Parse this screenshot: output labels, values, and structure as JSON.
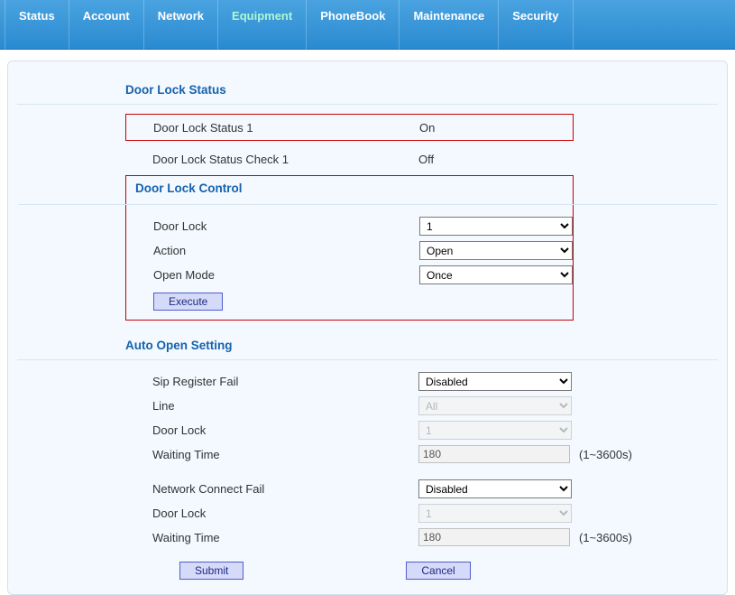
{
  "nav": {
    "items": [
      "Status",
      "Account",
      "Network",
      "Equipment",
      "PhoneBook",
      "Maintenance",
      "Security"
    ],
    "activeIndex": 3
  },
  "sections": {
    "status_title": "Door Lock Status",
    "control_title": "Door Lock Control",
    "autoopen_title": "Auto Open Setting"
  },
  "status": {
    "row1_label": "Door Lock Status 1",
    "row1_value": "On",
    "row2_label": "Door Lock Status Check 1",
    "row2_value": "Off"
  },
  "control": {
    "door_lock_label": "Door Lock",
    "door_lock_value": "1",
    "action_label": "Action",
    "action_value": "Open",
    "open_mode_label": "Open Mode",
    "open_mode_value": "Once",
    "execute_label": "Execute"
  },
  "autoopen": {
    "sip_fail_label": "Sip Register Fail",
    "sip_fail_value": "Disabled",
    "line_label": "Line",
    "line_value": "All",
    "door_lock_label": "Door Lock",
    "door_lock_value": "1",
    "wait_label": "Waiting Time",
    "wait_value": "180",
    "wait_hint": "(1~3600s)",
    "net_fail_label": "Network Connect Fail",
    "net_fail_value": "Disabled",
    "door_lock2_value": "1",
    "wait2_value": "180"
  },
  "footer": {
    "submit_label": "Submit",
    "cancel_label": "Cancel"
  }
}
